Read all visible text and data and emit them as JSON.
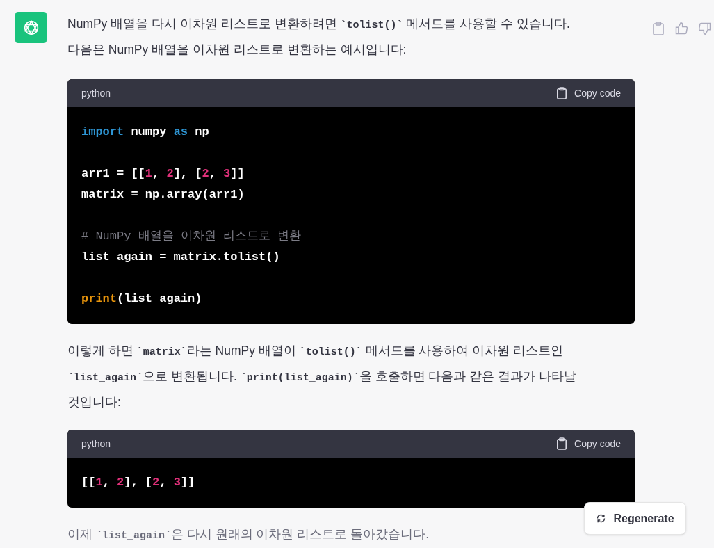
{
  "message": {
    "paragraphs_top": [
      [
        {
          "text": "NumPy 배열을 다시 이차원 리스트로 변환하려면 ",
          "code": false
        },
        {
          "text": "`tolist()`",
          "code": true
        },
        {
          "text": " 메서드를 사용할 수 있습니다. 다음은 NumPy 배열을 이차원 리스트로 변환하는 예시입니다:",
          "code": false
        }
      ]
    ],
    "blocks": [
      {
        "language": "python",
        "copy_label": "Copy code",
        "line_groups": [
          [
            [
              {
                "kind": "keyword",
                "text": "import"
              },
              {
                "kind": "plain",
                "text": " numpy "
              },
              {
                "kind": "keyword",
                "text": "as"
              },
              {
                "kind": "plain",
                "text": " np"
              }
            ]
          ],
          [
            [
              {
                "kind": "plain",
                "text": "arr1 = [["
              },
              {
                "kind": "number",
                "text": "1"
              },
              {
                "kind": "plain",
                "text": ", "
              },
              {
                "kind": "number",
                "text": "2"
              },
              {
                "kind": "plain",
                "text": "], ["
              },
              {
                "kind": "number",
                "text": "2"
              },
              {
                "kind": "plain",
                "text": ", "
              },
              {
                "kind": "number",
                "text": "3"
              },
              {
                "kind": "plain",
                "text": "]]"
              }
            ],
            [
              {
                "kind": "plain",
                "text": "matrix = np.array(arr1)"
              }
            ]
          ],
          [
            [
              {
                "kind": "comment",
                "text": "# NumPy 배열을 이차원 리스트로 변환"
              }
            ],
            [
              {
                "kind": "plain",
                "text": "list_again = matrix.tolist()"
              }
            ]
          ],
          [
            [
              {
                "kind": "builtin",
                "text": "print"
              },
              {
                "kind": "plain",
                "text": "(list_again)"
              }
            ]
          ]
        ]
      },
      {
        "language": "python",
        "copy_label": "Copy code",
        "line_groups": [
          [
            [
              {
                "kind": "plain",
                "text": "[["
              },
              {
                "kind": "number",
                "text": "1"
              },
              {
                "kind": "plain",
                "text": ", "
              },
              {
                "kind": "number",
                "text": "2"
              },
              {
                "kind": "plain",
                "text": "], ["
              },
              {
                "kind": "number",
                "text": "2"
              },
              {
                "kind": "plain",
                "text": ", "
              },
              {
                "kind": "number",
                "text": "3"
              },
              {
                "kind": "plain",
                "text": "]]"
              }
            ]
          ]
        ]
      }
    ],
    "paragraphs_middle": [
      [
        {
          "text": "이렇게 하면 ",
          "code": false
        },
        {
          "text": "`matrix`",
          "code": true
        },
        {
          "text": "라는 NumPy 배열이 ",
          "code": false
        },
        {
          "text": "`tolist()`",
          "code": true
        },
        {
          "text": " 메서드를 사용하여 이차원 리스트인 ",
          "code": false
        },
        {
          "text": "`list_again`",
          "code": true
        },
        {
          "text": "으로 변환됩니다. ",
          "code": false
        },
        {
          "text": "`print(list_again)`",
          "code": true
        },
        {
          "text": "을 호출하면 다음과 같은 결과가 나타날 것입니다:",
          "code": false
        }
      ]
    ],
    "paragraphs_bottom": [
      [
        {
          "text": "이제 ",
          "code": false
        },
        {
          "text": "`list_again`",
          "code": true
        },
        {
          "text": "은 다시 원래의 이차원 리스트로 돌아갔습니다.",
          "code": false
        }
      ]
    ]
  },
  "regenerate_button": "Regenerate"
}
